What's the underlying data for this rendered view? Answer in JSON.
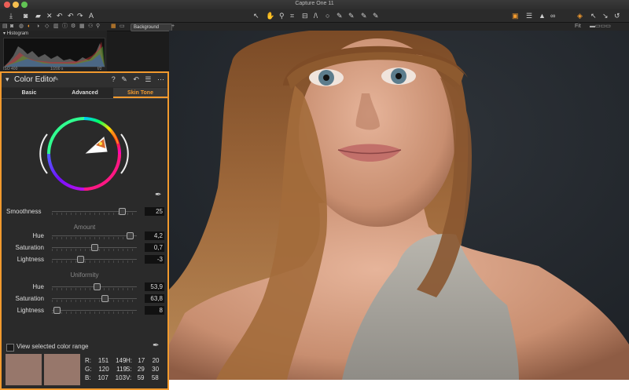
{
  "window": {
    "title": "Capture One 11",
    "traffic_lights": [
      "#ec5f57",
      "#f5bf4f",
      "#61c454"
    ]
  },
  "toolbar": {
    "left_icons": [
      "import-icon",
      "camera-icon",
      "folder-icon",
      "close-icon",
      "undo-icon",
      "redo-icon",
      "redo-all-icon",
      "text-icon"
    ],
    "center_icons": [
      "cursor-icon",
      "pan-icon",
      "zoom-icon",
      "crop-icon",
      "straighten-icon",
      "keystone-icon",
      "spot-icon",
      "brush-icon",
      "gradient-icon",
      "picker-icon"
    ],
    "right_icons": [
      "edit-icon",
      "list-icon",
      "warning-icon",
      "glasses-icon",
      "layers-icon",
      "copy-icon",
      "apply-icon",
      "reset-icon"
    ],
    "accent": "#f29a2e"
  },
  "subbar": {
    "background_select": "Background",
    "zoom": "Fit"
  },
  "histogram": {
    "title": "Histogram",
    "iso": "ISO 400",
    "shutter": "1/200 s",
    "aperture": "f/2"
  },
  "editor": {
    "title": "Color Editor",
    "tabs": [
      {
        "label": "Basic"
      },
      {
        "label": "Advanced"
      },
      {
        "label": "Skin Tone"
      }
    ],
    "active_tab": 2,
    "smoothness": {
      "label": "Smoothness",
      "value": "25",
      "level": 0.82
    },
    "amount": {
      "title": "Amount",
      "hue": {
        "label": "Hue",
        "value": "4,2",
        "level": 0.92
      },
      "saturation": {
        "label": "Saturation",
        "value": "0,7",
        "level": 0.5
      },
      "lightness": {
        "label": "Lightness",
        "value": "-3",
        "level": 0.33
      }
    },
    "uniformity": {
      "title": "Uniformity",
      "hue": {
        "label": "Hue",
        "value": "53,9",
        "level": 0.53
      },
      "saturation": {
        "label": "Saturation",
        "value": "63,8",
        "level": 0.62
      },
      "lightness": {
        "label": "Lightness",
        "value": "8",
        "level": 0.06
      }
    },
    "view_range": {
      "label": "View selected color range"
    },
    "swatch_color": "#97776b",
    "readout": {
      "R": {
        "label": "R:",
        "a": "151",
        "b": "149"
      },
      "G": {
        "label": "G:",
        "a": "120",
        "b": "119"
      },
      "B": {
        "label": "B:",
        "a": "107",
        "b": "103"
      },
      "H": {
        "label": "H:",
        "a": "17",
        "b": "20"
      },
      "S": {
        "label": "S:",
        "a": "29",
        "b": "30"
      },
      "V": {
        "label": "V:",
        "a": "59",
        "b": "58"
      }
    }
  }
}
